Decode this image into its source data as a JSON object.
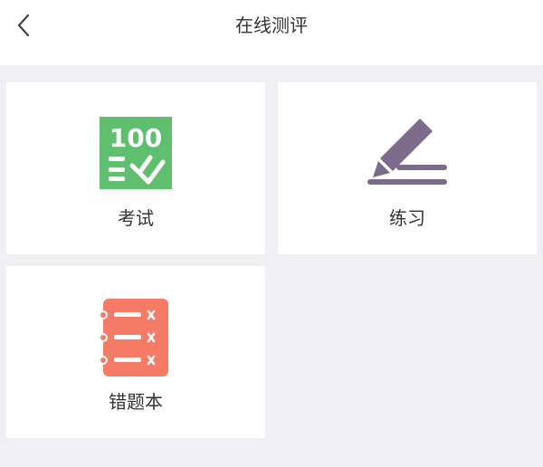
{
  "header": {
    "title": "在线测评",
    "back_icon": "chevron-left-icon"
  },
  "tiles": [
    {
      "label": "考试",
      "icon": "exam-score-icon",
      "color": "#5fbf6f"
    },
    {
      "label": "练习",
      "icon": "pencil-icon",
      "color": "#7e6a8c"
    },
    {
      "label": "错题本",
      "icon": "wrong-list-icon",
      "color": "#f57b67"
    }
  ],
  "exam_icon_text": "100",
  "colors": {
    "background": "#efeff4",
    "tile": "#ffffff",
    "text": "#333333"
  }
}
